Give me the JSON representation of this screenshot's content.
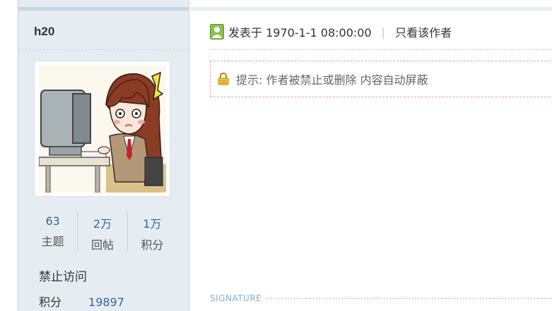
{
  "author": {
    "name": "h20",
    "stats": [
      {
        "value": "63",
        "label": "主题"
      },
      {
        "value": "2万",
        "label": "回帖"
      },
      {
        "value": "1万",
        "label": "积分"
      }
    ],
    "group": "禁止访问",
    "score_label": "积分",
    "score_value": "19897"
  },
  "post": {
    "posted_at": "发表于 1970-1-1 08:00:00",
    "separator": "|",
    "only_author": "只看该作者",
    "notice": "提示: 作者被禁止或删除 内容自动屏蔽",
    "signature_label": "SIGNATURE"
  }
}
